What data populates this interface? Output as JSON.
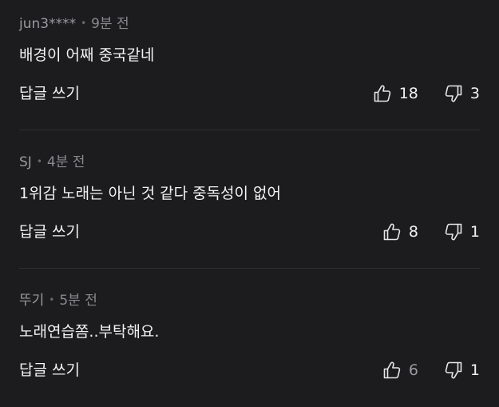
{
  "comments": [
    {
      "author": "jun3****",
      "time": "9분 전",
      "text": "배경이 어째 중국같네",
      "reply_label": "답글 쓰기",
      "likes": "18",
      "dislikes": "3"
    },
    {
      "author": "SJ",
      "time": "4분 전",
      "text": "1위감 노래는 아닌 것 같다 중독성이 없어",
      "reply_label": "답글 쓰기",
      "likes": "8",
      "dislikes": "1"
    },
    {
      "author": "뚜기",
      "time": "5분 전",
      "text": "노래연습쫌..부탁해요.",
      "reply_label": "답글 쓰기",
      "likes": "6",
      "dislikes": "1"
    }
  ],
  "icons": {
    "like": "thumbs-up-outline-icon",
    "dislike": "thumbs-down-outline-icon"
  },
  "colors": {
    "background": "#1c1c1e",
    "text": "#f2f2f2",
    "meta": "#8a8a8e",
    "divider": "#2f2f33"
  }
}
